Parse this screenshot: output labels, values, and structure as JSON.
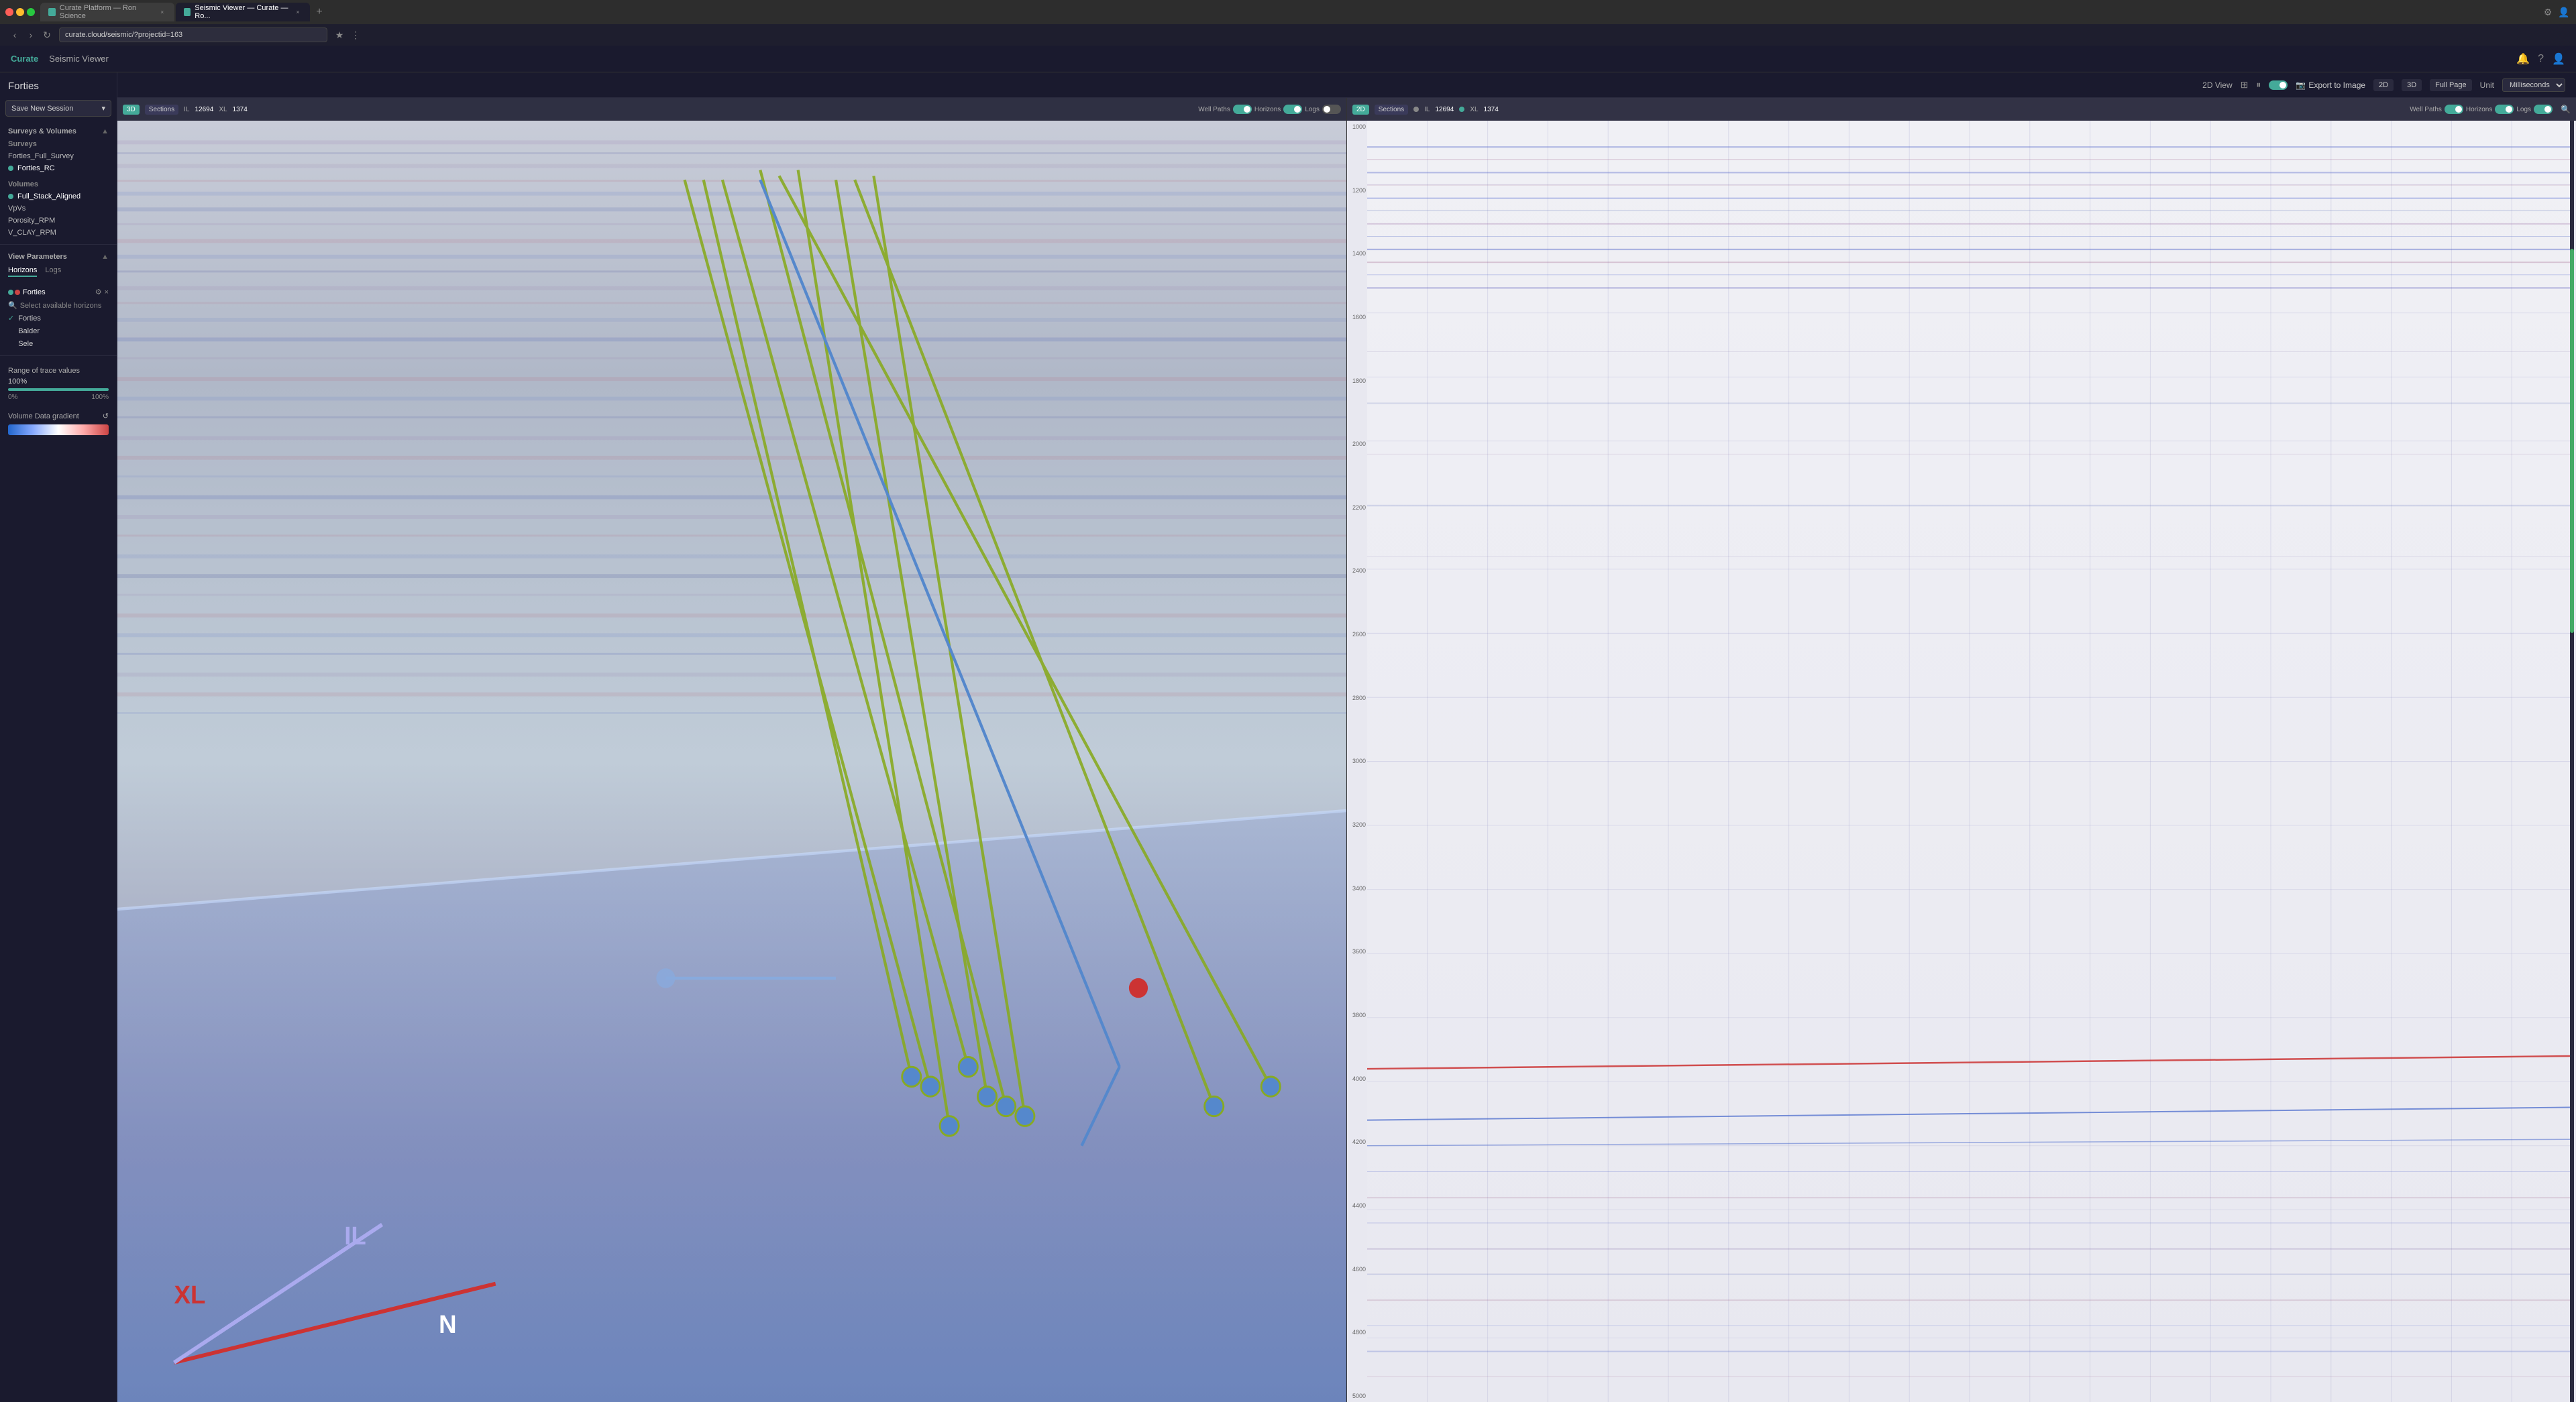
{
  "browser": {
    "tabs": [
      {
        "label": "Curate Platform — Ron Science",
        "active": false,
        "favicon_color": "#4a9"
      },
      {
        "label": "Seismic Viewer — Curate — Ro...",
        "active": true,
        "favicon_color": "#4a9"
      }
    ],
    "address": "curate.cloud/seismic/?projectid=163"
  },
  "nav": {
    "logo": "Curate",
    "title": "Seismic Viewer",
    "icons": [
      "bell",
      "question",
      "user"
    ]
  },
  "sidebar": {
    "project_name": "Forties",
    "save_session_label": "Save New Session",
    "surveys_section": "Surveys & Volumes",
    "surveys_label": "Surveys",
    "surveys": [
      {
        "name": "Forties_Full_Survey",
        "active": false
      },
      {
        "name": "Forties_RC",
        "active": true,
        "dot_color": "#4a9"
      }
    ],
    "volumes_label": "Volumes",
    "volumes": [
      {
        "name": "Full_Stack_Aligned",
        "active": true,
        "dot_color": "#4a9"
      },
      {
        "name": "VpVs",
        "active": false
      },
      {
        "name": "Porosity_RPM",
        "active": false
      },
      {
        "name": "V_CLAY_RPM",
        "active": false
      }
    ],
    "view_params": "View Parameters",
    "tabs": [
      "Horizons",
      "Logs"
    ],
    "active_tab": "Horizons",
    "active_horizon": {
      "name": "Forties",
      "colors": [
        "#4a9",
        "#cc4444"
      ]
    },
    "search_placeholder": "Select available horizons",
    "horizons_list": [
      {
        "name": "Forties",
        "checked": true
      },
      {
        "name": "Balder",
        "checked": false
      },
      {
        "name": "Sele",
        "checked": false
      }
    ],
    "range_label": "Range of trace values",
    "range_max": "100%",
    "range_min": "0%",
    "range_max_right": "100%",
    "gradient_label": "Volume Data gradient",
    "gradient_refresh": "↺"
  },
  "view_bar": {
    "label": "2D View",
    "export_label": "Export to Image",
    "btn_2d": "2D",
    "btn_3d": "3D",
    "full_page": "Full Page",
    "unit_label": "Unit",
    "unit_value": "Milliseconds",
    "grid_icon": "⊞",
    "pause_icon": "⏸"
  },
  "viewer_3d": {
    "btn_label": "3D",
    "sections_label": "Sections",
    "il_label": "IL",
    "il_value": "12694",
    "xl_label": "XL",
    "xl_value": "1374",
    "well_paths_label": "Well Paths",
    "horizons_label": "Horizons",
    "logs_label": "Logs",
    "xl_axis": "XL",
    "il_axis": "IL",
    "n_axis": "N"
  },
  "viewer_2d": {
    "btn_label": "2D",
    "sections_label": "Sections",
    "il_label": "IL",
    "il_value": "12694",
    "xl_label": "XL",
    "xl_value": "1374",
    "well_paths_label": "Well Paths",
    "horizons_label": "Horizons",
    "logs_label": "Logs",
    "axis_labels": [
      "1000",
      "1200",
      "1400",
      "1600",
      "1800",
      "2000",
      "2200",
      "2400",
      "2600",
      "2800",
      "3000",
      "3200",
      "3400",
      "3600",
      "3800",
      "4000",
      "4200",
      "4400",
      "4600",
      "4800",
      "5000"
    ]
  }
}
